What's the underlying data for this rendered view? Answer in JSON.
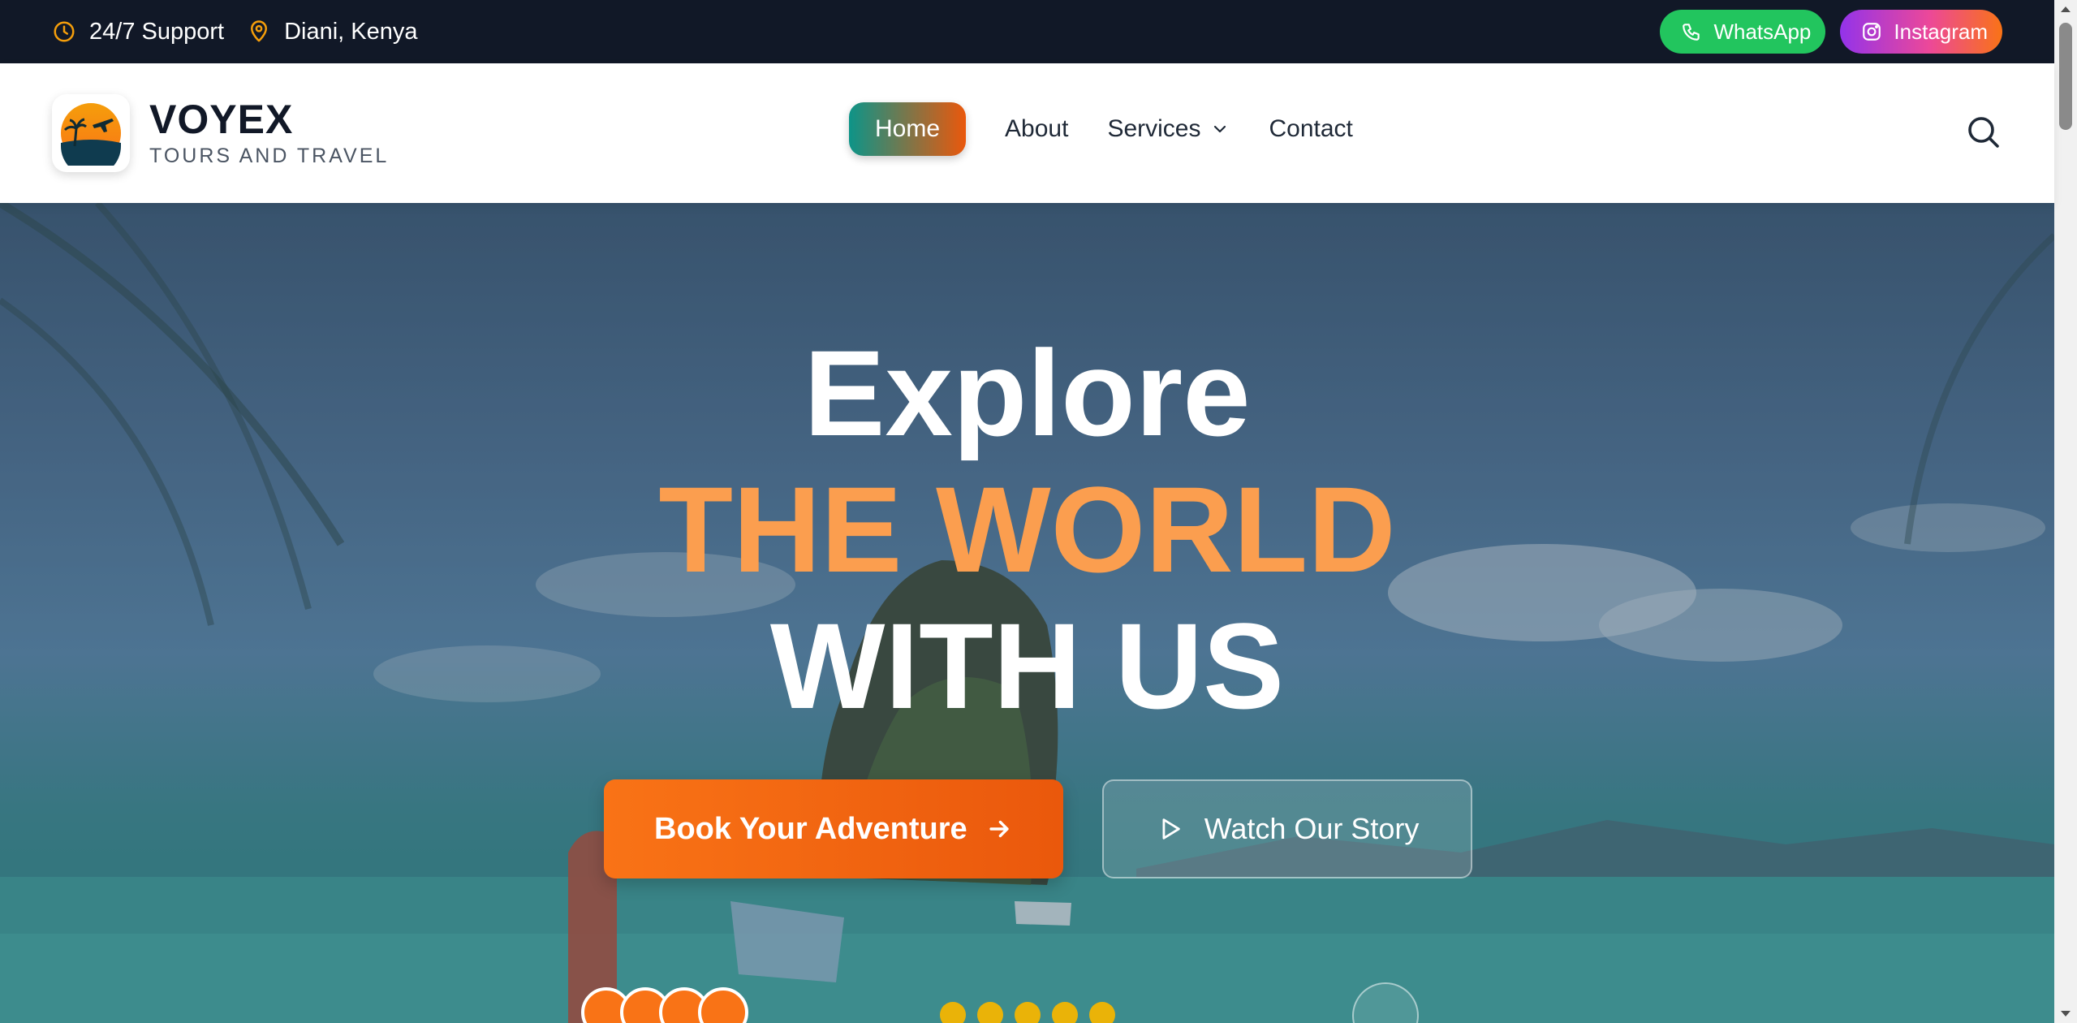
{
  "topbar": {
    "support_text": "24/7 Support",
    "location_text": "Diani, Kenya",
    "whatsapp_label": "WhatsApp",
    "instagram_label": "Instagram"
  },
  "brand": {
    "name": "VOYEX",
    "tagline": "TOURS AND TRAVEL"
  },
  "nav": {
    "items": [
      {
        "label": "Home",
        "active": true
      },
      {
        "label": "About"
      },
      {
        "label": "Services",
        "has_dropdown": true
      },
      {
        "label": "Contact"
      }
    ]
  },
  "hero": {
    "line1": "Explore",
    "line2": "THE WORLD",
    "line3": "WITH US",
    "primary_cta": "Book Your Adventure",
    "secondary_cta": "Watch Our Story"
  },
  "colors": {
    "topbar_bg": "#111827",
    "accent_orange": "#f97316",
    "accent_teal": "#0d9488",
    "whatsapp_green": "#22c55e",
    "headline_orange": "#fb9e4f"
  },
  "icons": {
    "support": "clock-icon",
    "location": "map-pin-icon",
    "whatsapp": "phone-icon",
    "instagram": "instagram-icon",
    "search": "search-icon",
    "dropdown": "chevron-down-icon",
    "cta_arrow": "arrow-right-icon",
    "play": "play-icon"
  }
}
